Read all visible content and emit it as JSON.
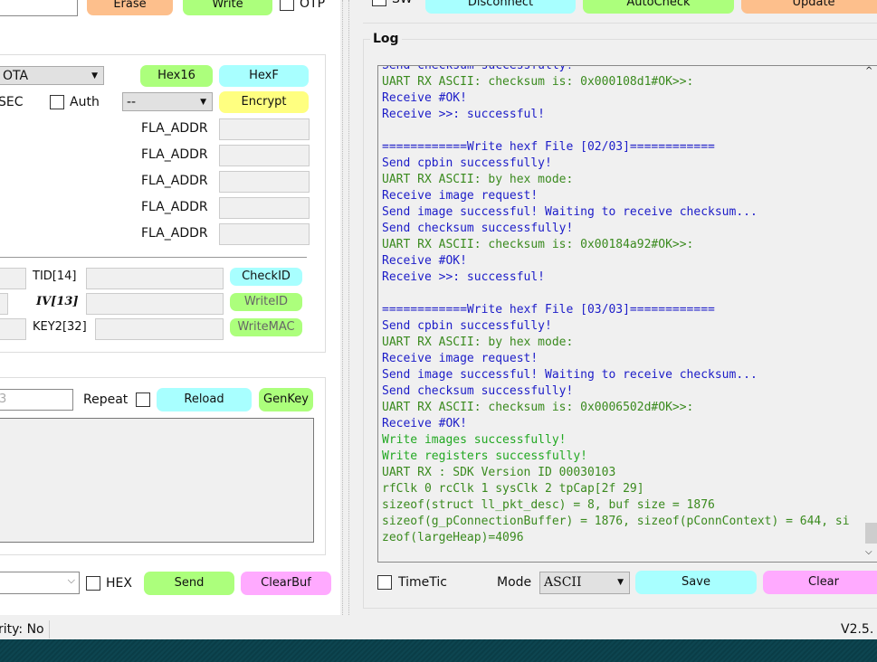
{
  "top": {
    "erase": "Erase",
    "write": "Write",
    "otp": "OTP",
    "sw": "SW",
    "disconnect": "Disconnect",
    "autocheck": "AutoCheck",
    "update": "Update"
  },
  "config": {
    "mode_value": "OTA",
    "hex16": "Hex16",
    "hexf": "HexF",
    "sec_label": "SEC",
    "auth_label": "Auth",
    "enc_select": "--",
    "encrypt": "Encrypt",
    "fla_labels": [
      "FLA_ADDR",
      "FLA_ADDR",
      "FLA_ADDR",
      "FLA_ADDR",
      "FLA_ADDR"
    ],
    "tid_label": "TID[14]",
    "iv_label": "IV[13]",
    "key2_label": "KEY2[32]",
    "checkid": "CheckID",
    "writeid": "WriteID",
    "writemac": "WriteMAC"
  },
  "send": {
    "input_partial": "3",
    "repeat_label": "Repeat",
    "reload": "Reload",
    "genkey": "GenKey",
    "hex_label": "HEX",
    "send": "Send",
    "clearbuf": "ClearBuf"
  },
  "status": {
    "left": "rity: No",
    "version": "V2.5."
  },
  "log": {
    "title": "Log",
    "timetic": "TimeTic",
    "mode_label": "Mode",
    "mode_value": "ASCII",
    "save": "Save",
    "clear": "Clear",
    "colors": {
      "blue": "#1c1cc8",
      "green": "#3a8a1e",
      "bright_green": "#22a822"
    },
    "lines": [
      {
        "t": "Send checksum successfully!",
        "c": "blue"
      },
      {
        "t": "UART RX ASCII: checksum is: 0x000108d1#OK>>:",
        "c": "green"
      },
      {
        "t": "Receive #OK!",
        "c": "blue"
      },
      {
        "t": "Receive >>: successful!",
        "c": "blue"
      },
      {
        "t": "",
        "c": "blue"
      },
      {
        "t": "============Write hexf File [02/03]============",
        "c": "blue"
      },
      {
        "t": "Send cpbin successfully!",
        "c": "blue"
      },
      {
        "t": "UART RX ASCII: by hex mode:",
        "c": "green"
      },
      {
        "t": "Receive image request!",
        "c": "blue"
      },
      {
        "t": "Send image successful! Waiting to receive checksum...",
        "c": "blue"
      },
      {
        "t": "Send checksum successfully!",
        "c": "blue"
      },
      {
        "t": "UART RX ASCII: checksum is: 0x00184a92#OK>>:",
        "c": "green"
      },
      {
        "t": "Receive #OK!",
        "c": "blue"
      },
      {
        "t": "Receive >>: successful!",
        "c": "blue"
      },
      {
        "t": "",
        "c": "blue"
      },
      {
        "t": "============Write hexf File [03/03]============",
        "c": "blue"
      },
      {
        "t": "Send cpbin successfully!",
        "c": "blue"
      },
      {
        "t": "UART RX ASCII: by hex mode:",
        "c": "green"
      },
      {
        "t": "Receive image request!",
        "c": "blue"
      },
      {
        "t": "Send image successful! Waiting to receive checksum...",
        "c": "blue"
      },
      {
        "t": "Send checksum successfully!",
        "c": "blue"
      },
      {
        "t": "UART RX ASCII: checksum is: 0x0006502d#OK>>:",
        "c": "green"
      },
      {
        "t": "Receive #OK!",
        "c": "blue"
      },
      {
        "t": "Write images successfully!",
        "c": "bright_green"
      },
      {
        "t": "Write registers successfully!",
        "c": "bright_green"
      },
      {
        "t": "UART RX : SDK Version ID 00030103",
        "c": "green"
      },
      {
        "t": "rfClk 0 rcClk 1 sysClk 2 tpCap[2f 29]",
        "c": "green"
      },
      {
        "t": "sizeof(struct ll_pkt_desc) = 8, buf size = 1876",
        "c": "green"
      },
      {
        "t": "sizeof(g_pConnectionBuffer) = 1876, sizeof(pConnContext) = 644, si",
        "c": "green"
      },
      {
        "t": "zeof(largeHeap)=4096",
        "c": "green"
      }
    ]
  }
}
